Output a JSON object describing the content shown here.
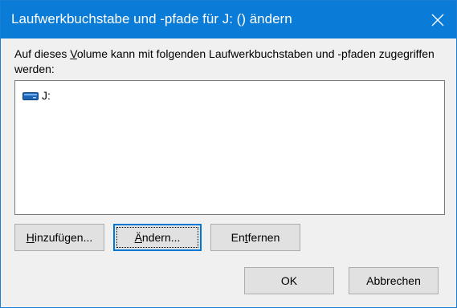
{
  "window": {
    "title": "Laufwerkbuchstabe und -pfade für J: () ändern"
  },
  "description": {
    "before_mnemonic": "Auf dieses ",
    "mnemonic": "V",
    "after_mnemonic": "olume kann mit folgenden Laufwerkbuchstaben und -pfaden zugegriffen werden:"
  },
  "list": {
    "items": [
      {
        "icon": "drive-icon",
        "label": "J:"
      }
    ]
  },
  "buttons": {
    "add": {
      "mnemonic": "H",
      "rest": "inzufügen..."
    },
    "change": {
      "mnemonic": "Ä",
      "rest": "ndern..."
    },
    "remove": {
      "prefix": "En",
      "mnemonic": "t",
      "rest": "fernen"
    },
    "ok": "OK",
    "cancel": "Abbrechen"
  },
  "colors": {
    "titlebar": "#0a7bd6",
    "focus_border": "#0078d7",
    "button_face": "#e1e1e1",
    "dialog_bg": "#f0f0f0"
  }
}
